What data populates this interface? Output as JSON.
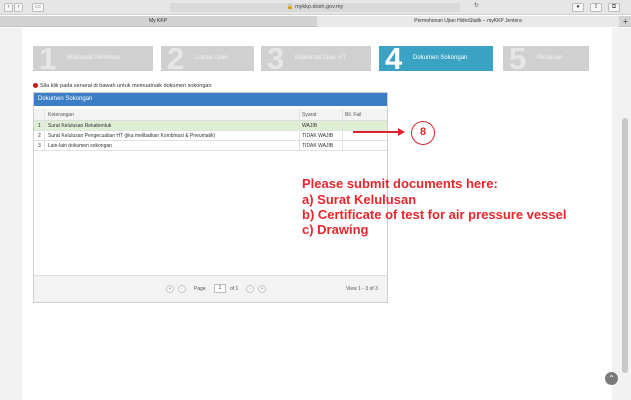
{
  "browser": {
    "url": "mykkp.dosh.gov.my",
    "tabs": [
      {
        "title": "My KKP"
      },
      {
        "title": "Permohonan Ujian HidroStatik – myKKP Jentera"
      }
    ]
  },
  "steps": [
    {
      "number": "1",
      "label": "Maklumat Pemohon",
      "active": false
    },
    {
      "number": "2",
      "label": "Lokasi Ujian",
      "active": false
    },
    {
      "number": "3",
      "label": "Maklumat Ujian HT",
      "active": false
    },
    {
      "number": "4",
      "label": "Dokumen Sokongan",
      "active": true
    },
    {
      "number": "5",
      "label": "Perakuan",
      "active": false
    }
  ],
  "instruction": "Sila klik pada senarai di bawah untuk memuatnaik dokumen sokongan",
  "panel": {
    "title": "Dokumen Sokongan",
    "columns": {
      "keterangan": "Keterangan",
      "syarat": "Syarat",
      "bil_fail": "Bil. Fail"
    },
    "rows": [
      {
        "no": "1",
        "keterangan": "Surat Kelulusan Rekabentuk",
        "syarat": "WAJIB",
        "bil_fail": "",
        "selected": true
      },
      {
        "no": "2",
        "keterangan": "Surat Kelulusan Pengecualian HT (jika melibatkan Kombinasi & Pneumatik)",
        "syarat": "TIDAK WAJIB",
        "bil_fail": "",
        "selected": false
      },
      {
        "no": "3",
        "keterangan": "Lain-lain dokumen sokongan",
        "syarat": "TIDAK WAJIB",
        "bil_fail": "",
        "selected": false
      }
    ],
    "pager": {
      "page_label": "Page",
      "page_value": "1",
      "of_label": "of 1",
      "view_label": "View 1 - 3 of 3"
    }
  },
  "annotation": {
    "callout_number": "8",
    "lines": [
      "Please submit documents here:",
      "a) Surat Kelulusan",
      "b) Certificate of test for air pressure vessel",
      "c) Drawing"
    ]
  },
  "colors": {
    "accent": "#3a7fc6",
    "step_active": "#3aa3c3",
    "annotation": "#e8262c",
    "selected_row": "#dfefd5"
  }
}
